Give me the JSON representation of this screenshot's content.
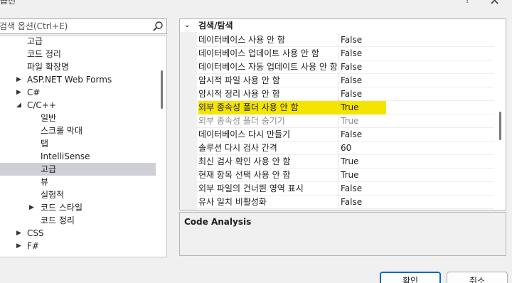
{
  "window": {
    "title": "옵션",
    "help_glyph": "?",
    "close_glyph": "✕"
  },
  "search": {
    "placeholder": "검색 옵션(Ctrl+E)"
  },
  "tree": {
    "items": [
      {
        "label": "고급"
      },
      {
        "label": "코드 정리"
      },
      {
        "label": "파일 확장명"
      },
      {
        "label": "ASP.NET Web Forms",
        "arrow": "▶"
      },
      {
        "label": "C#",
        "arrow": "▶"
      },
      {
        "label": "C/C++",
        "arrow": "◢"
      },
      {
        "label": "일반"
      },
      {
        "label": "스크롤 막대"
      },
      {
        "label": "탭"
      },
      {
        "label": "IntelliSense"
      },
      {
        "label": "고급",
        "selected": true
      },
      {
        "label": "뷰"
      },
      {
        "label": "실험적"
      },
      {
        "label": "코드 스타일",
        "arrow": "▶"
      },
      {
        "label": "코드 정리"
      },
      {
        "label": "CSS",
        "arrow": "▶"
      },
      {
        "label": "F#",
        "arrow": "▶"
      }
    ]
  },
  "grid": {
    "category": {
      "label": "검색/탐색",
      "arrow": "⌄"
    },
    "properties": [
      {
        "name": "데이터베이스 사용 안 함",
        "value": "False"
      },
      {
        "name": "데이터베이스 업데이트 사용 안 함",
        "value": "False"
      },
      {
        "name": "데이터베이스 자동 업데이트 사용 안 함",
        "value": "False"
      },
      {
        "name": "암시적 파일 사용 안 함",
        "value": "False"
      },
      {
        "name": "암시적 정리 사용 안 함",
        "value": "False"
      },
      {
        "name": "외부 종속성 폴더 사용 안 함",
        "value": "True",
        "highlight": true
      },
      {
        "name": "외부 종속성 폴더 숨기기",
        "value": "True",
        "disabled": true
      },
      {
        "name": "데이터베이스 다시 만들기",
        "value": "False"
      },
      {
        "name": "솔루션 다시 검사 간격",
        "value": "60"
      },
      {
        "name": "최신 검사 확인 사용 안 함",
        "value": "True"
      },
      {
        "name": "현재 항목 선택 사용 안 함",
        "value": "True"
      },
      {
        "name": "외부 파일의 건너뛴 영역 표시",
        "value": "False"
      },
      {
        "name": "유사 일치 비활성화",
        "value": "False"
      }
    ],
    "highlight_color": "#f5e400"
  },
  "description": {
    "title": "Code Analysis"
  },
  "buttons": {
    "ok": "확인",
    "cancel": "취소"
  },
  "colors": {
    "selection": "#cfcfd6",
    "accent": "#0067c0"
  }
}
